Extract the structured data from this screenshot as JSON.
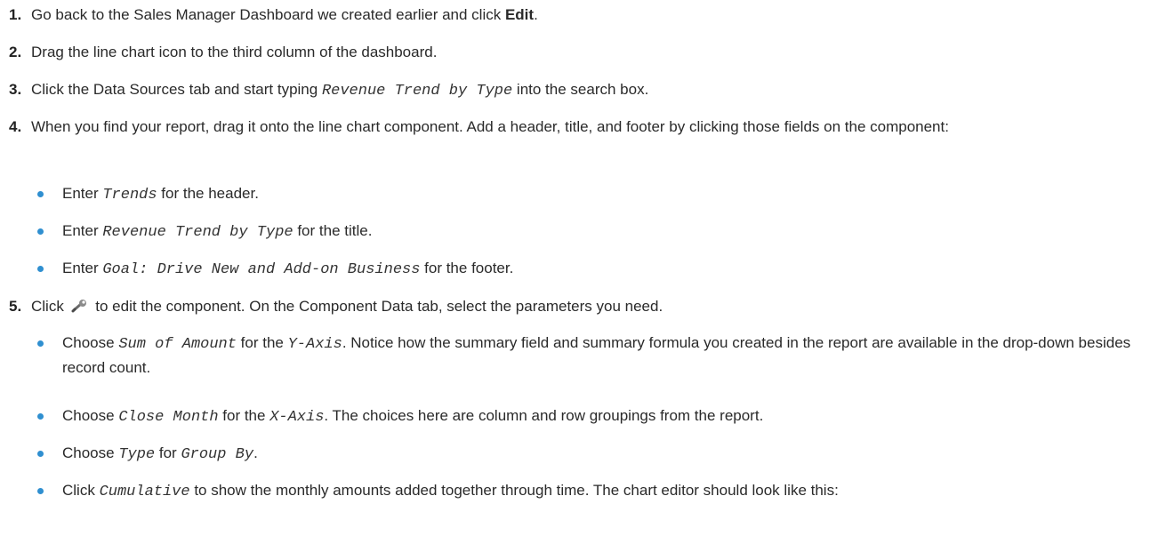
{
  "steps": [
    {
      "num": "1.",
      "before": "Go back to the Sales Manager Dashboard we created earlier and click ",
      "bold": "Edit",
      "after": "."
    },
    {
      "num": "2.",
      "text": "Drag the line chart icon to the third column of the dashboard."
    },
    {
      "num": "3.",
      "before": "Click the Data Sources tab and start typing ",
      "code": "Revenue Trend by Type",
      "after": " into the search box."
    },
    {
      "num": "4.",
      "text": "When you find your report, drag it onto the line chart component. Add a header, title, and footer by clicking those fields on the component:",
      "bullets": [
        {
          "before": "Enter ",
          "code": "Trends",
          "after": " for the header."
        },
        {
          "before": "Enter ",
          "code": "Revenue Trend by Type",
          "after": " for the title."
        },
        {
          "before": "Enter ",
          "code": "Goal: Drive New and Add-on Business",
          "after": " for the footer."
        }
      ]
    },
    {
      "num": "5.",
      "before": "Click ",
      "icon": "wrench-icon",
      "after": " to edit the component. On the Component Data tab, select the parameters you need.",
      "bullets": [
        {
          "before": "Choose ",
          "code1": "Sum of Amount",
          "mid": " for the ",
          "code2": "Y-Axis",
          "after": ". Notice how the summary field and summary formula you created in the report are available in the drop-down besides record count."
        },
        {
          "before": "Choose ",
          "code1": "Close Month",
          "mid": " for the ",
          "code2": "X-Axis",
          "after": ". The choices here are column and row groupings from the report."
        },
        {
          "before": "Choose ",
          "code1": "Type",
          "mid": " for ",
          "code2": "Group By",
          "after": "."
        },
        {
          "before": "Click ",
          "code": "Cumulative",
          "after": " to show the monthly amounts added together through time. The chart editor should look like this:"
        }
      ]
    }
  ]
}
